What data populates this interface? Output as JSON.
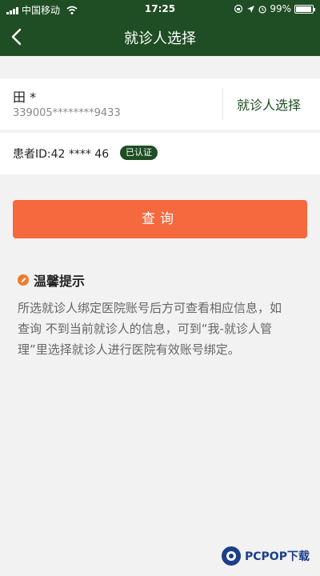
{
  "status_bar": {
    "carrier": "中国移动",
    "time": "17:25",
    "battery": "99%"
  },
  "nav": {
    "title": "就诊人选择",
    "back_icon": "chevron-left-icon"
  },
  "patient_card": {
    "name": "田 *",
    "id_number": "339005********9433",
    "select_label": "就诊人选择"
  },
  "patient_info": {
    "patient_id": "患者ID:42 **** 46",
    "badge": "已认证"
  },
  "actions": {
    "query_label": "查询"
  },
  "tips": {
    "icon": "info-icon",
    "title": "温馨提示",
    "text": "所选就诊人绑定医院账号后方可查看相应信息，如查询 不到当前就诊人的信息，可到“我-就诊人管理”里选择就诊人进行医院有效账号绑定。"
  },
  "watermark": {
    "text": "PCPOP下载"
  },
  "colors": {
    "header": "#1f4d24",
    "accent_button": "#f6683d",
    "badge": "#1f4d24",
    "tip_icon": "#f07b2c"
  }
}
